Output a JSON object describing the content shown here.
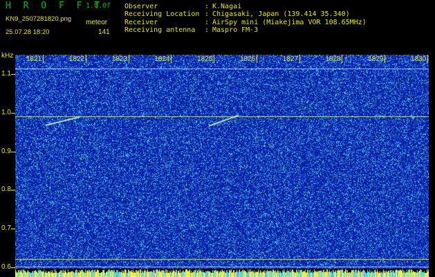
{
  "header": {
    "app_title": "H R O F F T",
    "version": "1.0.0f",
    "filename": "KN9_2507281820.png",
    "timestamp": "25.07.28 18:20",
    "meteor_label": "meteor",
    "meteor_count": "141"
  },
  "station_info": [
    {
      "key": "Observer",
      "value": "K.Nagai"
    },
    {
      "key": "Receiving Location",
      "value": "Chigasaki, Japan (139.414 35.340)"
    },
    {
      "key": "Receiver",
      "value": "AirSpy mini (Miakejima VOR 108.65MHz)"
    },
    {
      "key": "Receiving antenna",
      "value": "Maspro FM-3"
    }
  ],
  "info_separator": ":",
  "spectrogram": {
    "unit_label": "kHz",
    "y_axis": {
      "ticks": [
        "1.1",
        "1.0",
        "0.9",
        "0.8",
        "0.7",
        "0.6"
      ],
      "range_khz": [
        0.575,
        1.15
      ]
    },
    "x_axis": {
      "minutes": [
        "1821",
        "1822",
        "1823",
        "1824",
        "1825",
        "1826",
        "1827",
        "1828",
        "1829",
        "1830"
      ]
    },
    "carrier_lines_khz": [
      1.115,
      0.99,
      0.622,
      0.602
    ],
    "colors": {
      "background": "#0a22a8",
      "noise_light": "#4fb8ff",
      "noise_cyan": "#3ce6e0",
      "noise_green": "#60e060",
      "noise_yellow": "#f0f040",
      "axis_text": "#e8e800"
    }
  }
}
